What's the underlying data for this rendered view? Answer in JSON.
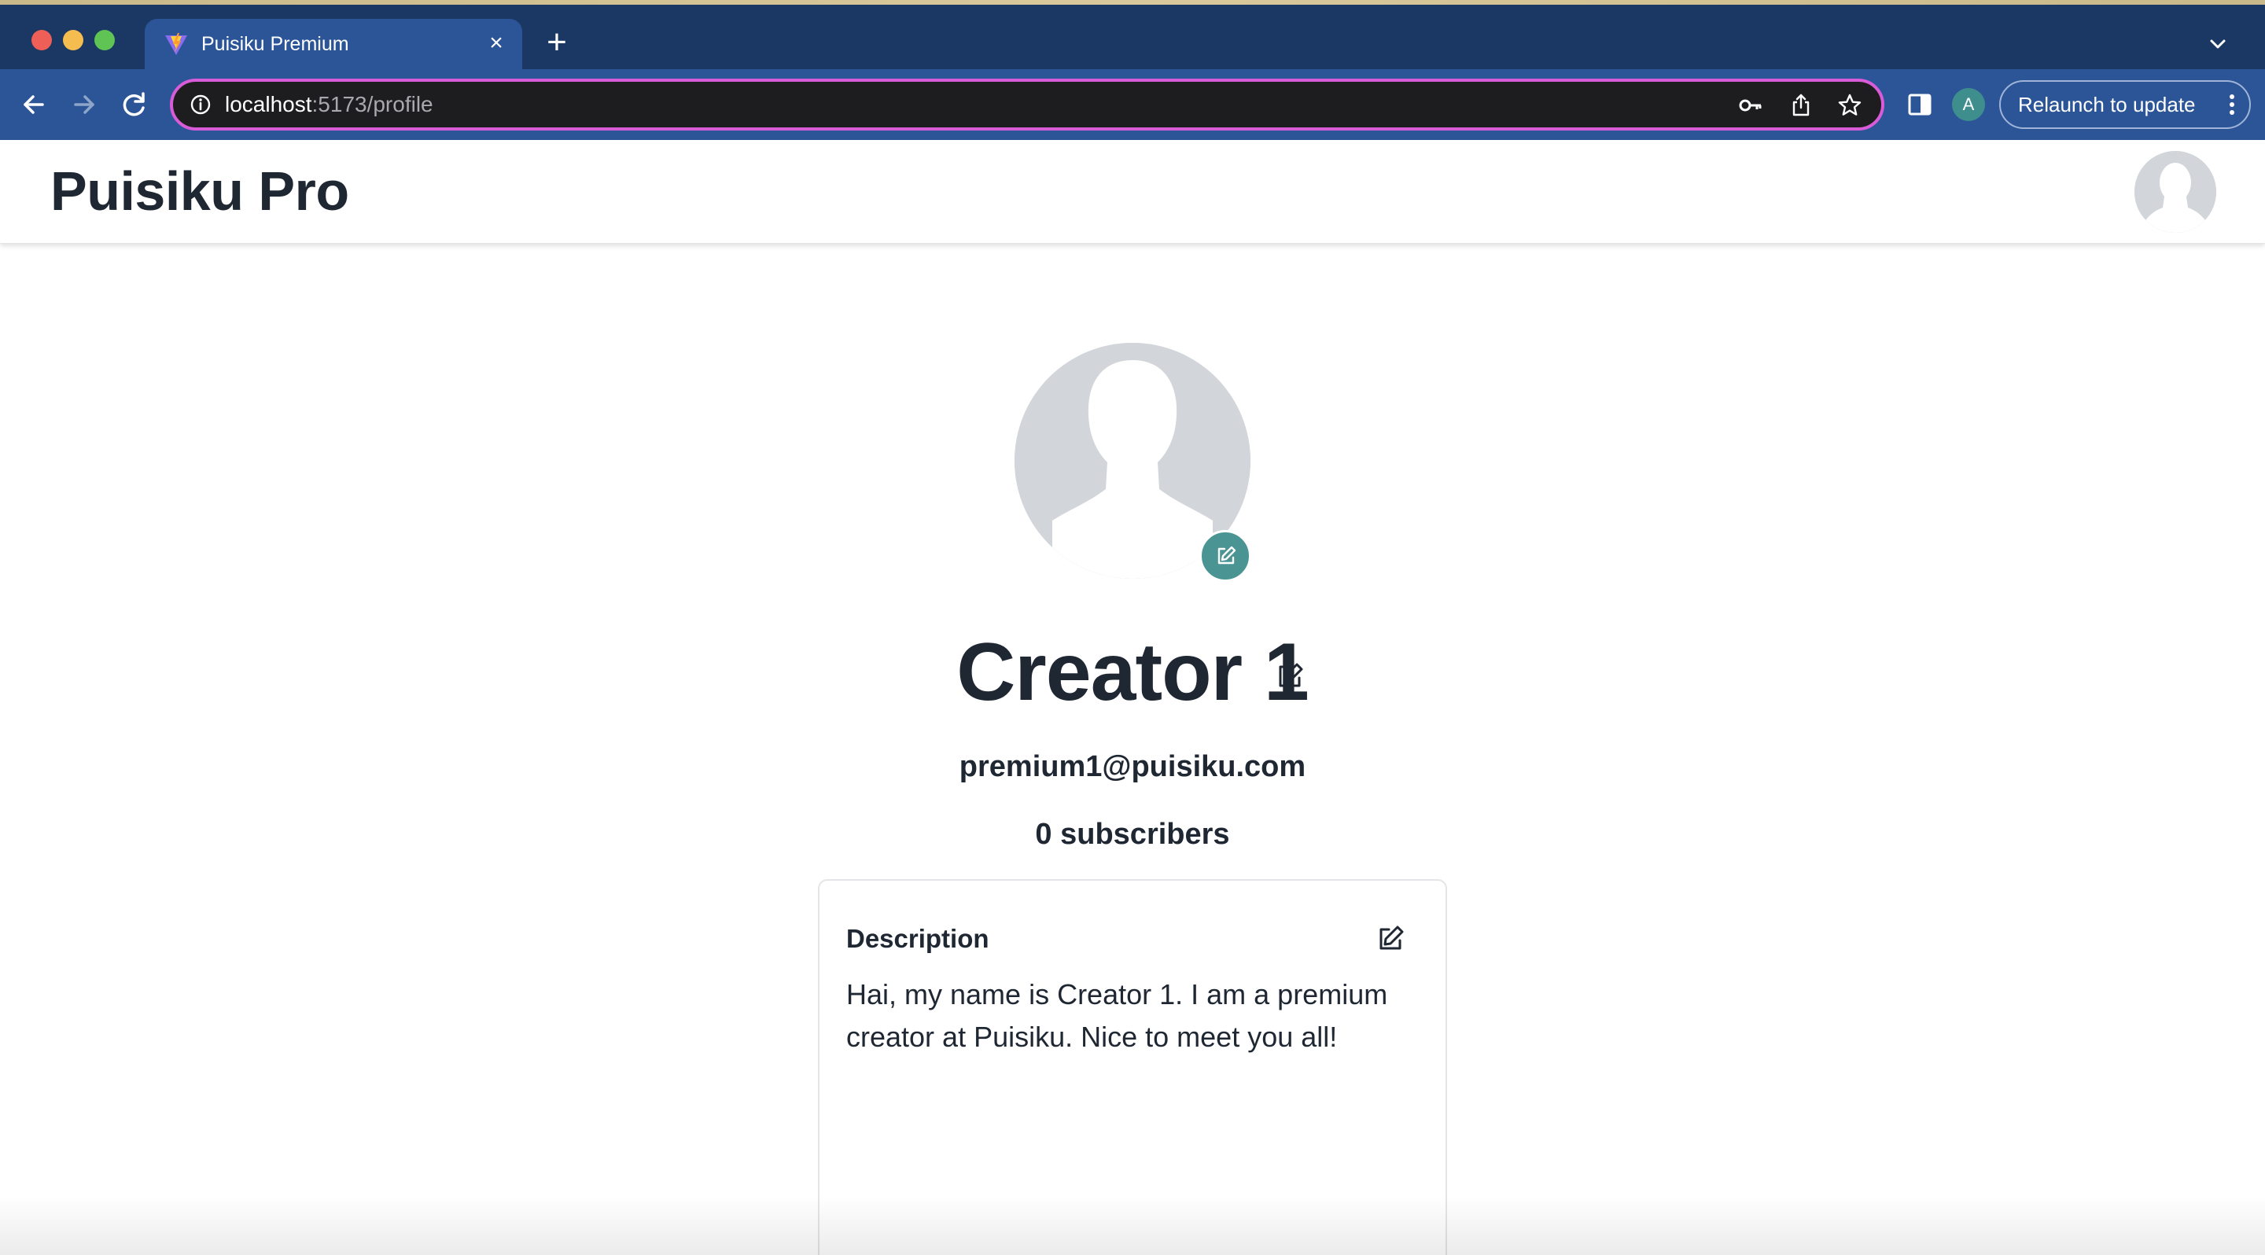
{
  "browser": {
    "tab": {
      "title": "Puisiku Premium",
      "close_glyph": "×"
    },
    "new_tab_glyph": "+",
    "address": {
      "host": "localhost",
      "path": ":5173/profile"
    },
    "profile_initial": "A",
    "relaunch_label": "Relaunch to update",
    "icons": [
      "back-icon",
      "forward-icon",
      "reload-icon",
      "info-icon",
      "key-icon",
      "share-icon",
      "star-icon",
      "side-panel-icon",
      "more-icon",
      "tab-list-icon"
    ]
  },
  "app": {
    "title": "Puisiku Pro"
  },
  "profile": {
    "name": "Creator 1",
    "email": "premium1@puisiku.com",
    "subscribers": "0 subscribers",
    "description_label": "Description",
    "description": "Hai, my name is Creator 1. I am a premium creator at Puisiku. Nice to meet you all!"
  },
  "colors": {
    "chrome_bg": "#1b3763",
    "toolbar_bg": "#2b5597",
    "omnibox_border": "#d85bd8",
    "accent_teal": "#4a9494",
    "text_dark": "#1f2733",
    "avatar_placeholder": "#d2d5da"
  }
}
